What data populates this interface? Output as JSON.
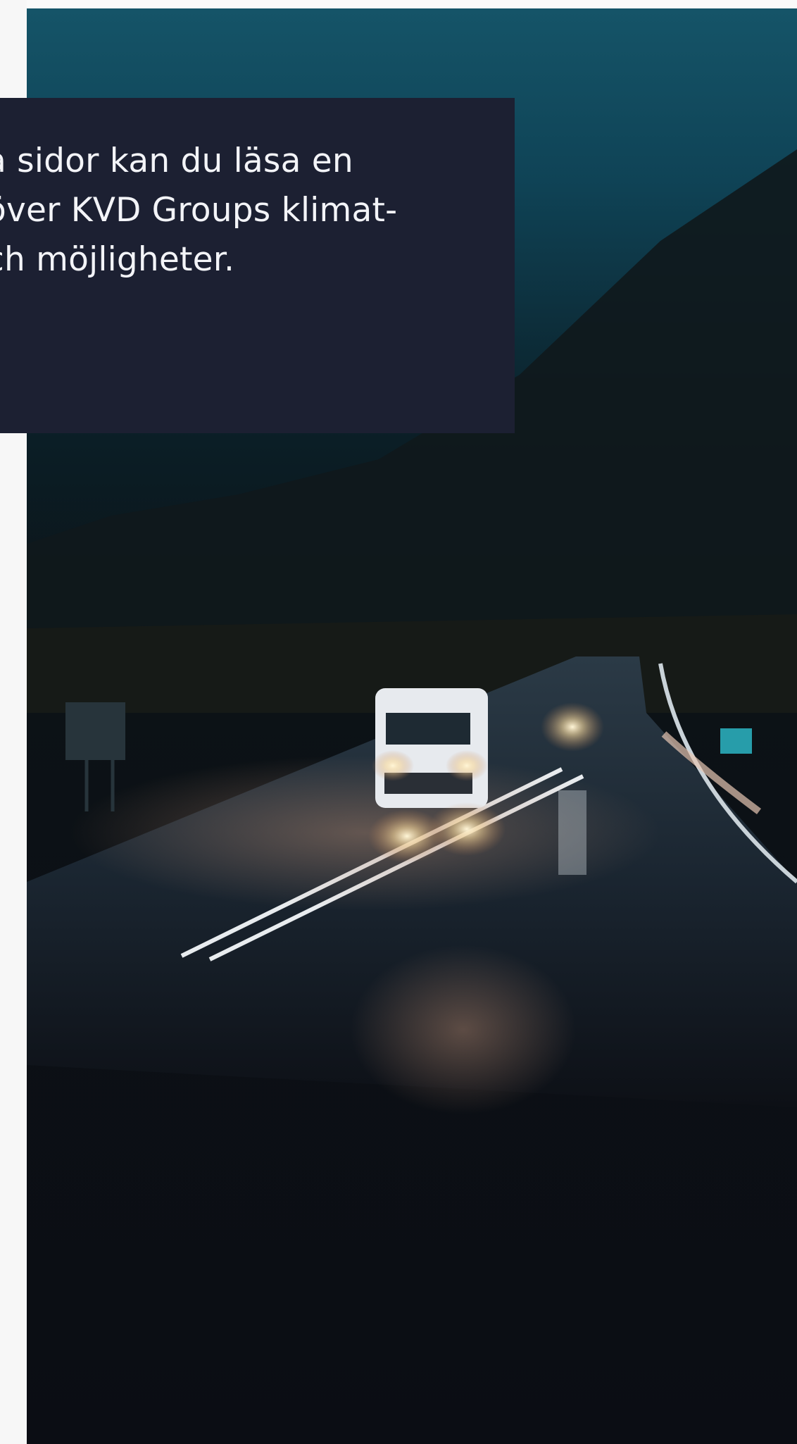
{
  "document": {
    "intro_text": "a sidor kan du läsa en\növer  KVD Groups klimat-\nch möjligheter."
  },
  "photo": {
    "subject": "white-van-on-wet-road-at-night-image"
  },
  "colors": {
    "overlay_box": "#1c2032",
    "overlay_text": "#f3f4f8",
    "sky_top": "#155468",
    "ground": "#0b0d14"
  }
}
